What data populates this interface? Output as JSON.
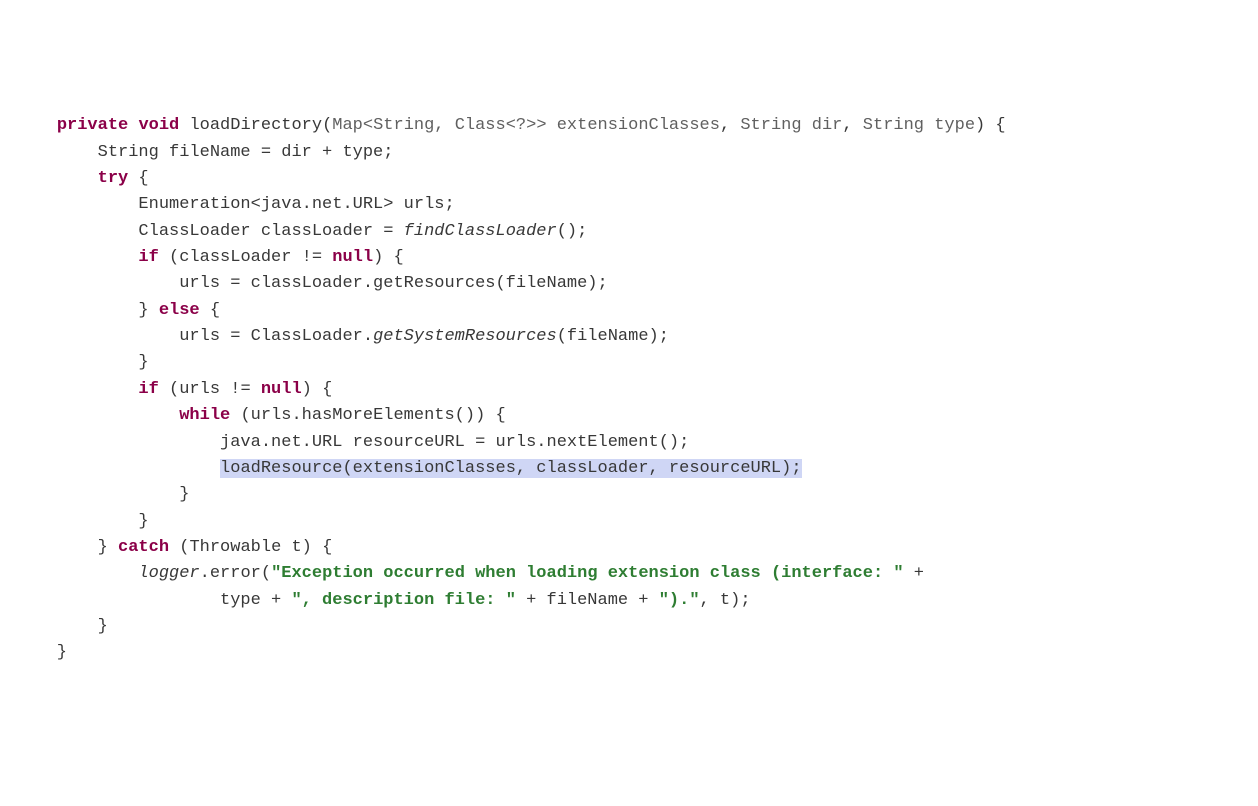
{
  "code": {
    "l1": {
      "k_private": "private",
      "k_void": "void",
      "method": "loadDirectory",
      "p1": "Map<String, Class<?>> extensionClasses",
      "p2": "String dir",
      "p3": "String type",
      "tail": ") {"
    },
    "l2": {
      "text": "        String fileName = dir + type;"
    },
    "l3": {
      "k_try": "try",
      "tail": " {"
    },
    "l4": {
      "text": "            Enumeration<java.net.URL> urls;"
    },
    "l5": {
      "a": "            ClassLoader classLoader = ",
      "call": "findClassLoader",
      "b": "();"
    },
    "l6": {
      "indent": "            ",
      "k_if": "if",
      "cond": " (classLoader != ",
      "k_null": "null",
      "tail": ") {"
    },
    "l7": {
      "text": "                urls = classLoader.getResources(fileName);"
    },
    "l8": {
      "indent": "            } ",
      "k_else": "else",
      "tail": " {"
    },
    "l9": {
      "a": "                urls = ClassLoader.",
      "call": "getSystemResources",
      "b": "(fileName);"
    },
    "l10": {
      "text": "            }"
    },
    "l11": {
      "indent": "            ",
      "k_if": "if",
      "cond": " (urls != ",
      "k_null": "null",
      "tail": ") {"
    },
    "l12": {
      "indent": "                ",
      "k_while": "while",
      "tail": " (urls.hasMoreElements()) {"
    },
    "l13": {
      "text": "                    java.net.URL resourceURL = urls.nextElement();"
    },
    "l14": {
      "indent": "                    ",
      "hl": "loadResource(extensionClasses, classLoader, resourceURL);"
    },
    "l15": {
      "text": "                }"
    },
    "l16": {
      "text": "            }"
    },
    "l17": {
      "indent": "        } ",
      "k_catch": "catch",
      "tail": " (Throwable t) {"
    },
    "l18": {
      "indent": "            ",
      "logger": "logger",
      "dot": ".error(",
      "s1": "\"Exception occurred when loading extension class (interface: \"",
      "plus": " +"
    },
    "l19": {
      "indent": "                    type + ",
      "s2": "\", description file: \"",
      "mid": " + fileName + ",
      "s3": "\").\"",
      "tail": ", t);"
    },
    "l20": {
      "text": "        }"
    },
    "l21": {
      "text": "    }"
    }
  }
}
